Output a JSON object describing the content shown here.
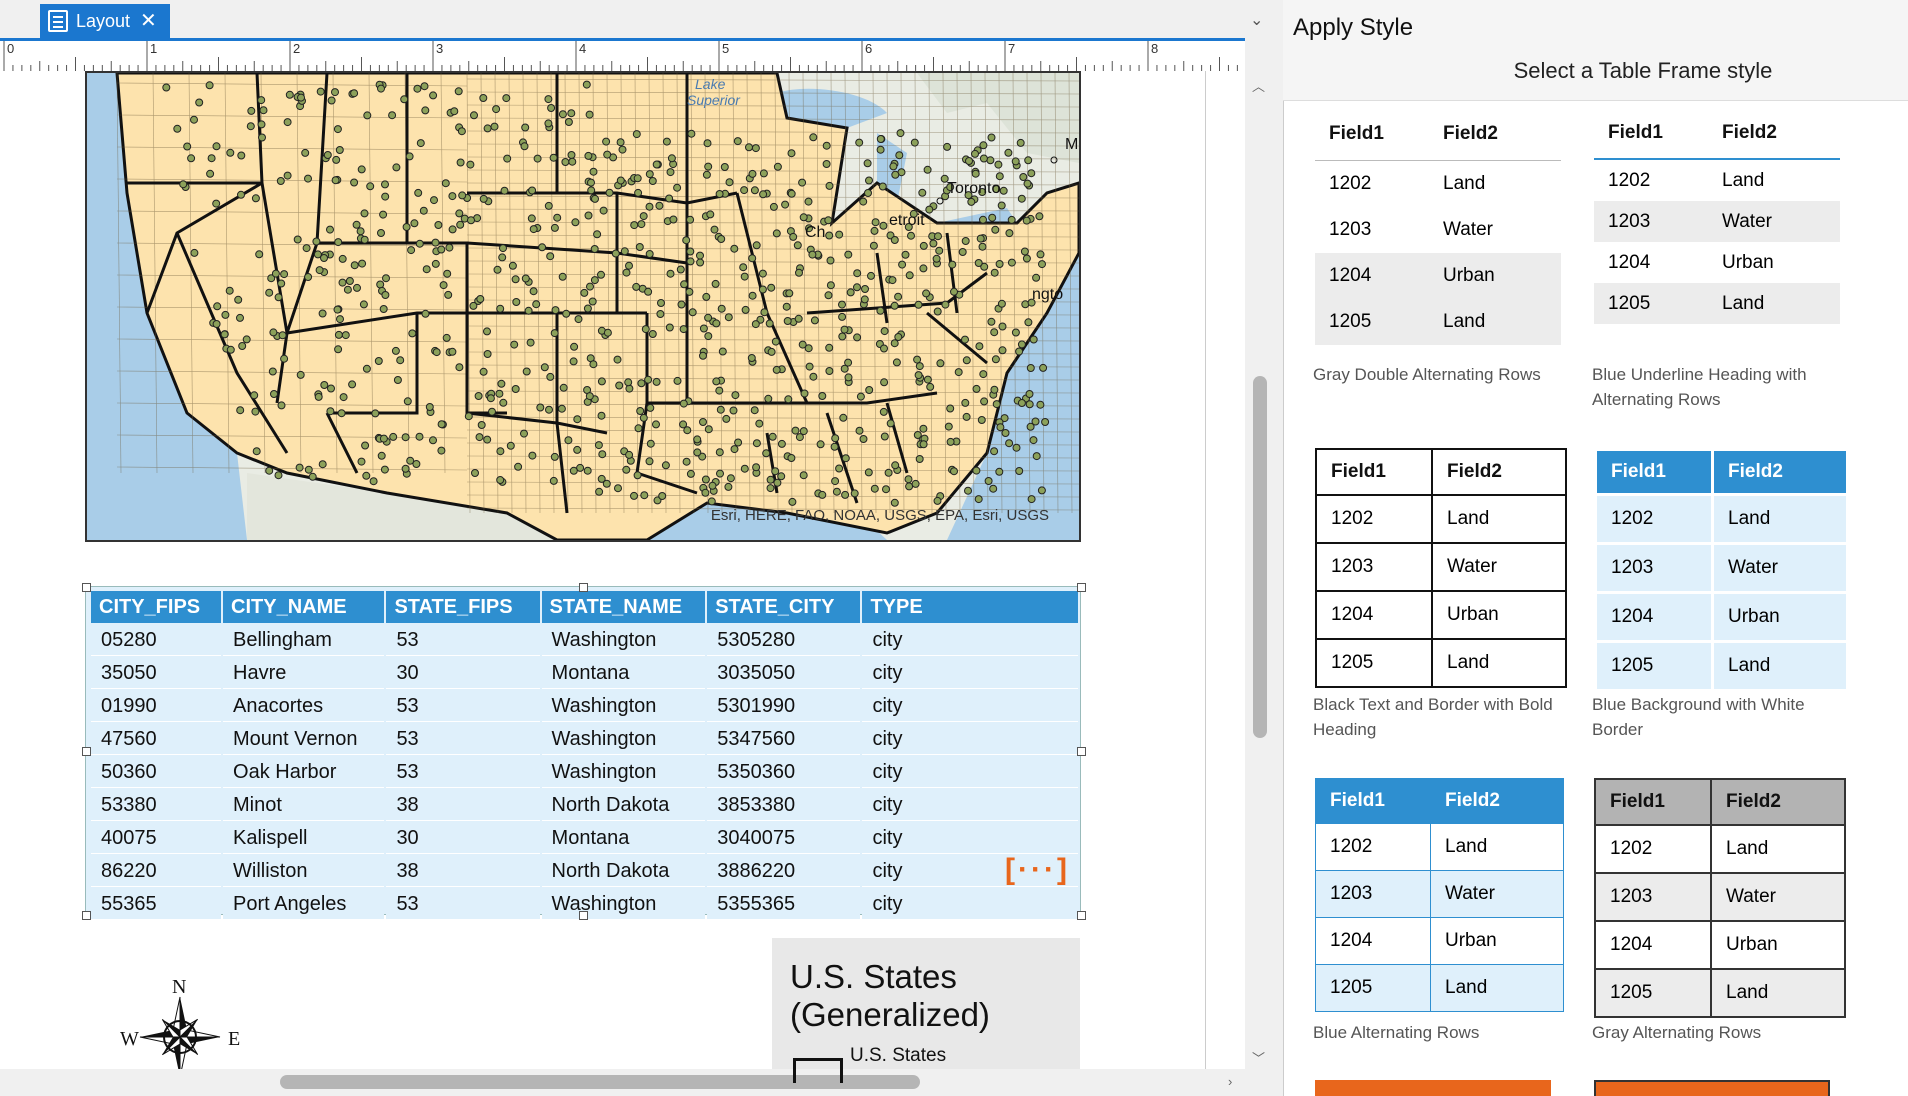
{
  "tab": {
    "label": "Layout"
  },
  "ruler": {
    "ticks": [
      "0",
      "1",
      "2",
      "3",
      "4",
      "5",
      "6",
      "7",
      "8"
    ]
  },
  "map": {
    "labels": {
      "lake": "Lake Superior",
      "lake_line1": "Lake",
      "lake_line2": "Superior",
      "toronto": "Toronto",
      "detroit": "etroit",
      "chicago": "Ch",
      "m": "M",
      "ngton": "ngto"
    },
    "attribution": "Esri, HERE, FAO, NOAA, USGS, EPA, Esri, USGS"
  },
  "attribute_table": {
    "columns": [
      "CITY_FIPS",
      "CITY_NAME",
      "STATE_FIPS",
      "STATE_NAME",
      "STATE_CITY",
      "TYPE"
    ],
    "rows": [
      [
        "05280",
        "Bellingham",
        "53",
        "Washington",
        "5305280",
        "city"
      ],
      [
        "35050",
        "Havre",
        "30",
        "Montana",
        "3035050",
        "city"
      ],
      [
        "01990",
        "Anacortes",
        "53",
        "Washington",
        "5301990",
        "city"
      ],
      [
        "47560",
        "Mount Vernon",
        "53",
        "Washington",
        "5347560",
        "city"
      ],
      [
        "50360",
        "Oak Harbor",
        "53",
        "Washington",
        "5350360",
        "city"
      ],
      [
        "53380",
        "Minot",
        "38",
        "North Dakota",
        "3853380",
        "city"
      ],
      [
        "40075",
        "Kalispell",
        "30",
        "Montana",
        "3040075",
        "city"
      ],
      [
        "86220",
        "Williston",
        "38",
        "North Dakota",
        "3886220",
        "city"
      ],
      [
        "55365",
        "Port Angeles",
        "53",
        "Washington",
        "5355365",
        "city"
      ]
    ],
    "more_indicator": "[···]"
  },
  "legend": {
    "title": "U.S. States (Generalized)",
    "item": "U.S. States"
  },
  "north_arrow": {
    "n": "N",
    "w": "W",
    "e": "E"
  },
  "panel": {
    "title": "Apply Style",
    "subtitle": "Select a Table Frame style",
    "styles": [
      {
        "name": "Gray Double Alternating Rows"
      },
      {
        "name": "Blue Underline Heading with Alternating Rows"
      },
      {
        "name": "Black Text and Border with Bold Heading"
      },
      {
        "name": "Blue Background with White Border"
      },
      {
        "name": "Blue Alternating Rows"
      },
      {
        "name": "Gray Alternating Rows"
      }
    ],
    "sample": {
      "headers": [
        "Field1",
        "Field2"
      ],
      "rows": [
        [
          "1202",
          "Land"
        ],
        [
          "1203",
          "Water"
        ],
        [
          "1204",
          "Urban"
        ],
        [
          "1205",
          "Land"
        ]
      ]
    }
  },
  "colors": {
    "accent": "#1b77cf",
    "table_header": "#2e8fd0",
    "table_bg": "#dff0fb",
    "state_fill": "#fde3ad",
    "water": "#a9cde8",
    "orange": "#e8661c"
  }
}
